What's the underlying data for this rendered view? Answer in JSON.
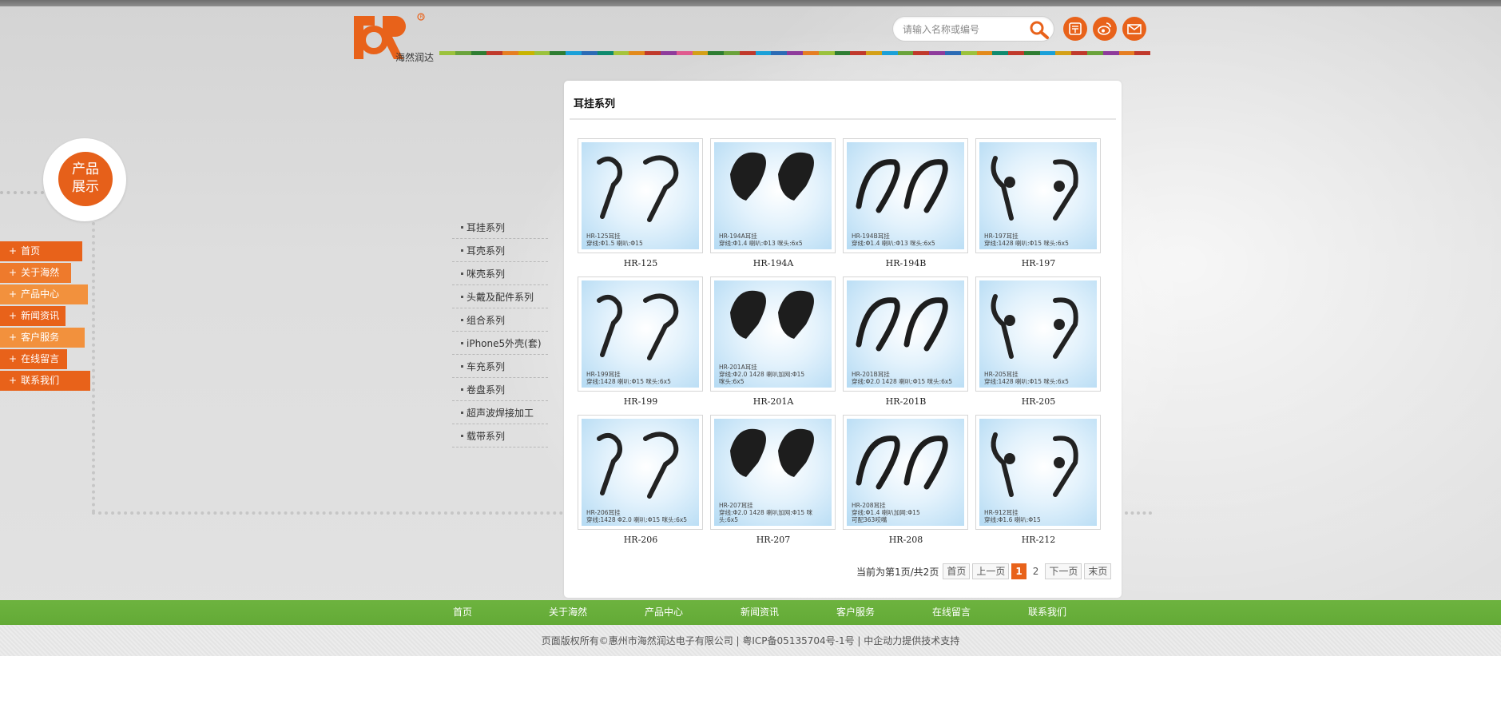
{
  "header": {
    "logo_text": "海然润达",
    "search_placeholder": "请输入名称或编号",
    "social": [
      "kaixin-icon",
      "weibo-icon",
      "mail-icon"
    ],
    "stripe_colors": [
      "#9bc23c",
      "#6aa33b",
      "#2e7d32",
      "#c0392b",
      "#e67e22",
      "#c8b400",
      "#9bc23c",
      "#2e7d32",
      "#1aa0d8",
      "#2b6bb5",
      "#0e8a6e",
      "#a5c43b",
      "#e38a1b",
      "#c0392b",
      "#8e3b9b",
      "#e05a8f",
      "#d4a017",
      "#2e7d32",
      "#6aa33b",
      "#c0392b",
      "#1aa0d8",
      "#2b6bb5",
      "#8e3b9b",
      "#e67e22",
      "#9bc23c",
      "#2e7d32",
      "#c0392b",
      "#d4a017",
      "#1aa0d8",
      "#6aa33b",
      "#c0392b",
      "#8e3b9b",
      "#2b6bb5",
      "#9bc23c",
      "#e38a1b",
      "#0e8a6e",
      "#c0392b",
      "#2e7d32",
      "#1aa0d8",
      "#d4a017",
      "#c0392b",
      "#6aa33b",
      "#8e3b9b",
      "#e67e22",
      "#c0392b"
    ]
  },
  "badge": {
    "line1": "产品",
    "line2": "展示"
  },
  "side_nav": [
    {
      "label": "首页",
      "color": "#e8621a",
      "width": 103
    },
    {
      "label": "关于海然",
      "color": "#ee7a2c",
      "width": 89
    },
    {
      "label": "产品中心",
      "color": "#f2913d",
      "width": 110
    },
    {
      "label": "新闻资讯",
      "color": "#e8621a",
      "width": 82
    },
    {
      "label": "客户服务",
      "color": "#f2913d",
      "width": 106
    },
    {
      "label": "在线留言",
      "color": "#e8621a",
      "width": 84
    },
    {
      "label": "联系我们",
      "color": "#e8621a",
      "width": 113
    }
  ],
  "categories": [
    "耳挂系列",
    "耳壳系列",
    "咪壳系列",
    "头戴及配件系列",
    "组合系列",
    "iPhone5外壳(套)",
    "车充系列",
    "卷盘系列",
    "超声波焊接加工",
    "载带系列"
  ],
  "panel": {
    "title": "耳挂系列"
  },
  "products": [
    {
      "name": "HR-125",
      "caption": "HR-125耳挂\n穿线:Φ1.5    喇叭:Φ15"
    },
    {
      "name": "HR-194A",
      "caption": "HR-194A耳挂\n穿线:Φ1.4  喇叭:Φ13  咪头:6x5"
    },
    {
      "name": "HR-194B",
      "caption": "HR-194B耳挂\n穿线:Φ1.4  喇叭:Φ13  咪头:6x5"
    },
    {
      "name": "HR-197",
      "caption": "HR-197耳挂\n穿线:1428  喇叭:Φ15  咪头:6x5"
    },
    {
      "name": "HR-199",
      "caption": "HR-199耳挂\n穿线:1428  喇叭:Φ15  咪头:6x5"
    },
    {
      "name": "HR-201A",
      "caption": "HR-201A耳挂\n穿线:Φ2.0 1428  喇叭加网:Φ15\n咪头:6x5"
    },
    {
      "name": "HR-201B",
      "caption": "HR-201B耳挂\n穿线:Φ2.0 1428 喇叭:Φ15 咪头:6x5"
    },
    {
      "name": "HR-205",
      "caption": "HR-205耳挂\n穿线:1428  喇叭:Φ15  咪头:6x5"
    },
    {
      "name": "HR-206",
      "caption": "HR-206耳挂\n穿线:1428 Φ2.0  喇叭:Φ15  咪头:6x5"
    },
    {
      "name": "HR-207",
      "caption": "HR-207耳挂\n穿线:Φ2.0 1428  喇叭加网:Φ15 咪头:6x5"
    },
    {
      "name": "HR-208",
      "caption": "HR-208耳挂\n穿线:Φ1.4  喇叭加网:Φ15\n可配363咬嘴"
    },
    {
      "name": "HR-212",
      "caption": "HR-912耳挂\n穿线:Φ1.6  喇叭:Φ15"
    }
  ],
  "pager": {
    "status": "当前为第1页/共2页",
    "first": "首页",
    "prev": "上一页",
    "pages": [
      "1",
      "2"
    ],
    "next": "下一页",
    "last": "末页"
  },
  "footer": {
    "nav": [
      "首页",
      "关于海然",
      "产品中心",
      "新闻资讯",
      "客户服务",
      "在线留言",
      "联系我们"
    ],
    "copyright": "页面版权所有©惠州市海然润达电子有限公司 | 粤ICP备05135704号-1号 | 中企动力提供技术支持"
  }
}
